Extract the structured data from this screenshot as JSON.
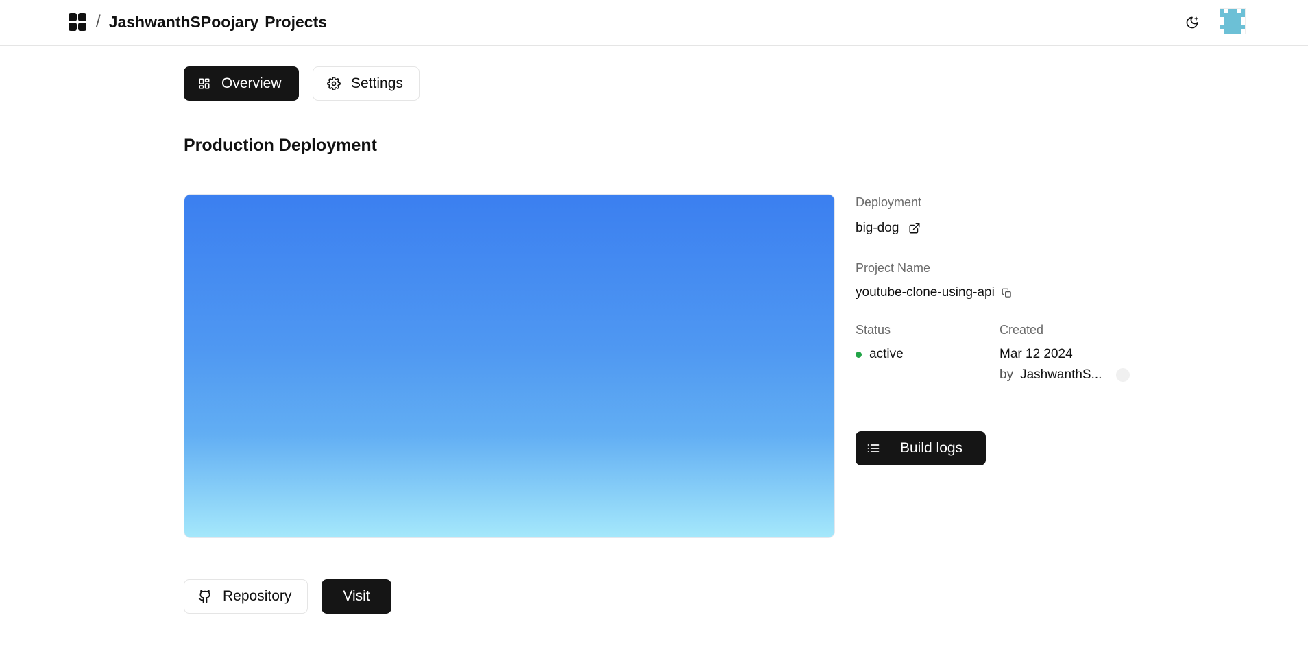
{
  "header": {
    "breadcrumb_user": "JashwanthSPoojary",
    "breadcrumb_section": "Projects",
    "separator": "/",
    "icons": {
      "logo": "grid-icon",
      "theme": "moon-icon",
      "avatar": "pixel-avatar"
    }
  },
  "tabs": [
    {
      "label": "Overview",
      "icon": "layout-grid-icon",
      "active": true
    },
    {
      "label": "Settings",
      "icon": "gear-icon",
      "active": false
    }
  ],
  "section": {
    "title": "Production Deployment"
  },
  "preview": {
    "gradient_top": "#3b7ff0",
    "gradient_bottom": "#a5e8fb"
  },
  "details": {
    "deployment_label": "Deployment",
    "deployment_value": "big-dog",
    "project_name_label": "Project Name",
    "project_name_value": "youtube-clone-using-api",
    "status_label": "Status",
    "status_value": "active",
    "status_color": "#22a447",
    "created_label": "Created",
    "created_value": "Mar 12 2024",
    "created_by_prefix": "by",
    "created_by_user": "JashwanthS..."
  },
  "buttons": {
    "build_logs": "Build logs",
    "repository": "Repository",
    "visit": "Visit"
  },
  "colors": {
    "primary_dark": "#151515",
    "border": "#e5e5e5"
  }
}
